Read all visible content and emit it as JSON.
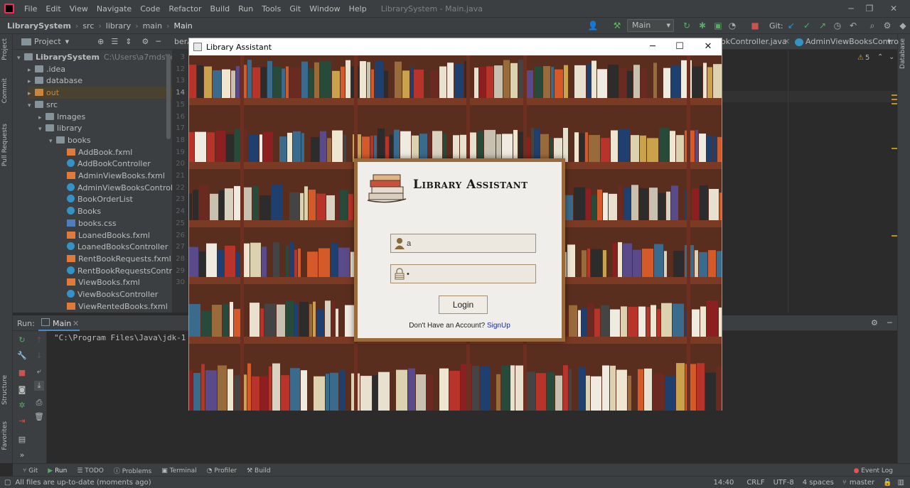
{
  "ide": {
    "menu": [
      "File",
      "Edit",
      "View",
      "Navigate",
      "Code",
      "Refactor",
      "Build",
      "Run",
      "Tools",
      "Git",
      "Window",
      "Help"
    ],
    "window_title": "LibrarySystem - Main.java",
    "breadcrumb": [
      "LibrarySystem",
      "src",
      "library",
      "main",
      "Main"
    ],
    "run_config": "Main",
    "git_label": "Git:",
    "project_panel_title": "Project",
    "left_strip": [
      "Project",
      "Commit",
      "Pull Requests",
      "Structure",
      "Favorites"
    ],
    "right_strip": [
      "Database"
    ],
    "editor_tabs": [
      "berA",
      "okController.java",
      "AdminViewBooksContro"
    ],
    "warnings_count": "5",
    "line_numbers": [
      "3",
      "12",
      "13",
      "14",
      "15",
      "16",
      "17",
      "18",
      "19",
      "20",
      "21",
      "22",
      "23",
      "24",
      "25",
      "26",
      "27",
      "28",
      "29",
      "30"
    ],
    "tree": [
      {
        "label": "LibrarySystem",
        "extra": "C:\\Users\\a7mds\\IdeaPro",
        "kind": "folder",
        "depth": 0,
        "chevron": "v"
      },
      {
        "label": ".idea",
        "kind": "folder",
        "depth": 1,
        "chevron": ">"
      },
      {
        "label": "database",
        "kind": "folder",
        "depth": 1,
        "chevron": ">"
      },
      {
        "label": "out",
        "kind": "folder-o",
        "depth": 1,
        "chevron": ">"
      },
      {
        "label": "src",
        "kind": "folder",
        "depth": 1,
        "chevron": "v"
      },
      {
        "label": "Images",
        "kind": "folder",
        "depth": 2,
        "chevron": ">"
      },
      {
        "label": "library",
        "kind": "folder",
        "depth": 2,
        "chevron": "v"
      },
      {
        "label": "books",
        "kind": "folder",
        "depth": 3,
        "chevron": "v"
      },
      {
        "label": "AddBook.fxml",
        "kind": "fx",
        "depth": 4
      },
      {
        "label": "AddBookController",
        "kind": "cls",
        "depth": 4
      },
      {
        "label": "AdminViewBooks.fxml",
        "kind": "fx",
        "depth": 4
      },
      {
        "label": "AdminViewBooksController",
        "kind": "cls",
        "depth": 4
      },
      {
        "label": "BookOrderList",
        "kind": "cls",
        "depth": 4
      },
      {
        "label": "Books",
        "kind": "cls",
        "depth": 4
      },
      {
        "label": "books.css",
        "kind": "css",
        "depth": 4
      },
      {
        "label": "LoanedBooks.fxml",
        "kind": "fx",
        "depth": 4
      },
      {
        "label": "LoanedBooksController",
        "kind": "cls",
        "depth": 4
      },
      {
        "label": "RentBookRequests.fxml",
        "kind": "fx",
        "depth": 4
      },
      {
        "label": "RentBookRequestsController",
        "kind": "cls",
        "depth": 4
      },
      {
        "label": "ViewBooks.fxml",
        "kind": "fx",
        "depth": 4
      },
      {
        "label": "ViewBooksController",
        "kind": "cls",
        "depth": 4
      },
      {
        "label": "ViewRentedBooks.fxml",
        "kind": "fx",
        "depth": 4
      }
    ],
    "run_panel": {
      "label": "Run:",
      "tab": "Main",
      "console_line": "\"C:\\Program Files\\Java\\jdk-1"
    },
    "bottom_tabs": [
      "Git",
      "Run",
      "TODO",
      "Problems",
      "Terminal",
      "Profiler",
      "Build"
    ],
    "event_log": "Event Log",
    "status": {
      "message": "All files are up-to-date (moments ago)",
      "position": "14:40",
      "line_ending": "CRLF",
      "encoding": "UTF-8",
      "indent": "4 spaces",
      "branch": "master"
    }
  },
  "dialog": {
    "title": "Library Assistant",
    "app_name": "Library Assistant",
    "username": {
      "value": "a",
      "placeholder": ""
    },
    "password": {
      "value": "•"
    },
    "login_label": "Login",
    "signup_prompt": "Don't Have an Account?",
    "signup_link": "SignUp"
  },
  "colors": {
    "ide_bg": "#2b2b2b",
    "panel_bg": "#3c3f41",
    "accent_link": "#1f2a9c",
    "card_border": "#9b6a3c",
    "shelf_wood": "#7a3a24"
  }
}
